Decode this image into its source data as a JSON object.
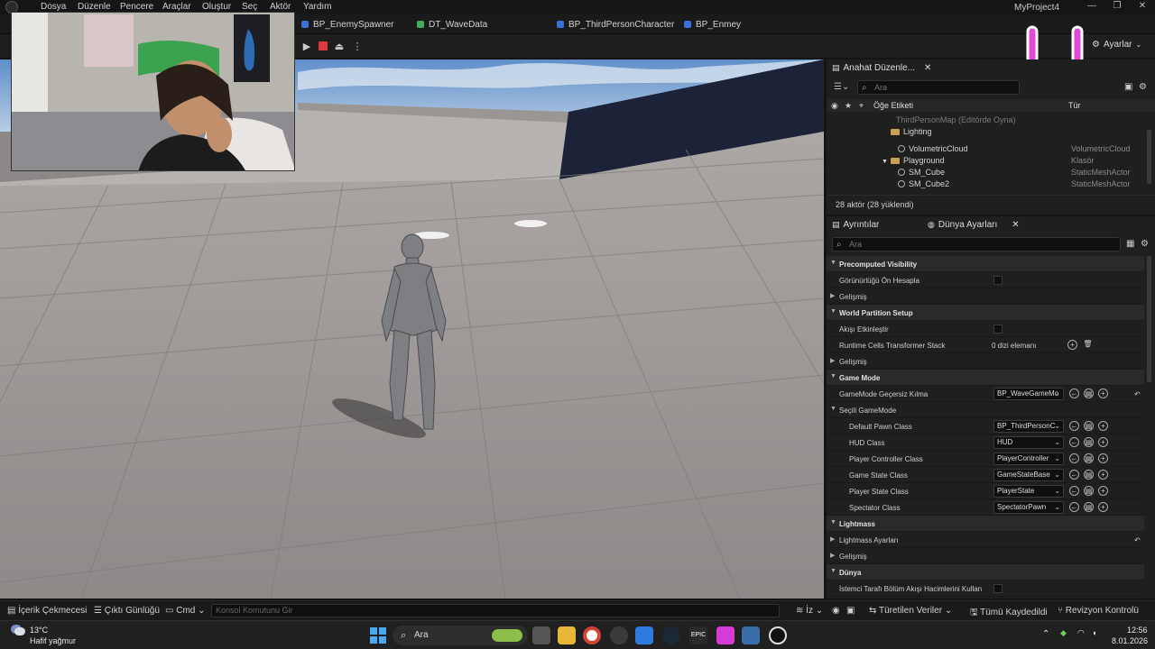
{
  "menubar": {
    "items": [
      "Dosya",
      "Düzenle",
      "Pencere",
      "Araçlar",
      "Oluştur",
      "Seç",
      "Aktör",
      "Yardım"
    ],
    "project_title": "MyProject4"
  },
  "tabs": [
    {
      "label": "BP_EnemySpawner",
      "color": "#3a6fd8"
    },
    {
      "label": "DT_WaveData",
      "color": "#3fae5a"
    },
    {
      "label": "BP_ThirdPersonCharacter",
      "color": "#3a6fd8"
    },
    {
      "label": "BP_Enmey",
      "color": "#3a6fd8"
    }
  ],
  "toolbar": {
    "settings_label": "Ayarlar"
  },
  "outliner": {
    "tab_label": "Anahat Düzenle...",
    "search_placeholder": "Ara",
    "col_label": "Öğe Etiketi",
    "col_type": "Tür",
    "rows": [
      {
        "label": "ThirdPersonMap (Editörde Oyna)",
        "type": "",
        "kind": "root"
      },
      {
        "label": "Lighting",
        "type": "",
        "kind": "folder"
      },
      {
        "label": "VolumetricCloud",
        "type": "VolumetricCloud",
        "kind": "mesh"
      },
      {
        "label": "Playground",
        "type": "Klasör",
        "kind": "folder"
      },
      {
        "label": "SM_Cube",
        "type": "StaticMeshActor",
        "kind": "mesh"
      },
      {
        "label": "SM_Cube2",
        "type": "StaticMeshActor",
        "kind": "mesh"
      }
    ],
    "actor_count": "28 aktör (28 yüklendi)"
  },
  "details": {
    "tab_details": "Ayrıntılar",
    "tab_world": "Dünya Ayarları",
    "search_placeholder": "Ara",
    "rows": [
      {
        "label": "Precomputed Visibility",
        "kind": "cat"
      },
      {
        "label": "Görünürlüğü Ön Hesapla",
        "kind": "check"
      },
      {
        "label": "Gelişmiş",
        "kind": "sub"
      },
      {
        "label": "World Partition Setup",
        "kind": "cat"
      },
      {
        "label": "Akışı Etkinleştir",
        "kind": "check"
      },
      {
        "label": "Runtime Cells Transformer Stack",
        "kind": "array",
        "value": "0 dizi elemanı"
      },
      {
        "label": "Gelişmiş",
        "kind": "sub"
      },
      {
        "label": "Game Mode",
        "kind": "cat"
      },
      {
        "label": "GameMode Geçersiz Kılma",
        "kind": "combo",
        "value": "BP_WaveGameMo"
      },
      {
        "label": "Seçili GameMode",
        "kind": "subopen"
      },
      {
        "label": "Default Pawn Class",
        "kind": "combo2",
        "value": "BP_ThirdPersonC"
      },
      {
        "label": "HUD Class",
        "kind": "combo2",
        "value": "HUD"
      },
      {
        "label": "Player Controller Class",
        "kind": "combo2",
        "value": "PlayerController"
      },
      {
        "label": "Game State Class",
        "kind": "combo2",
        "value": "GameStateBase"
      },
      {
        "label": "Player State Class",
        "kind": "combo2",
        "value": "PlayerState"
      },
      {
        "label": "Spectator Class",
        "kind": "combo2",
        "value": "SpectatorPawn"
      },
      {
        "label": "Lightmass",
        "kind": "cat"
      },
      {
        "label": "Lightmass Ayarları",
        "kind": "sub"
      },
      {
        "label": "Gelişmiş",
        "kind": "sub"
      },
      {
        "label": "Dünya",
        "kind": "cat"
      },
      {
        "label": "İstemci Tarafı Bölüm Akışı Hacimlerini Kullan",
        "kind": "check"
      }
    ]
  },
  "statusbar": {
    "content_drawer": "İçerik Çekmecesi",
    "output_log": "Çıktı Günlüğü",
    "cmd": "Cmd",
    "console_placeholder": "Konsol Komutunu Gir",
    "iz": "İz",
    "derived_data": "Türetilen Veriler",
    "all_saved": "Tümü Kaydedildi",
    "revision": "Revizyon Kontrolü"
  },
  "taskbar": {
    "temp": "13°C",
    "weather": "Hafif yağmur",
    "search": "Ara",
    "time": "12:56",
    "date": "8.01.2026"
  }
}
